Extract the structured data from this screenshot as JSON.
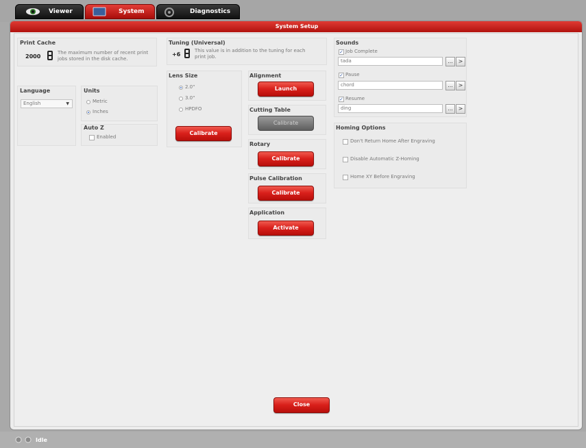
{
  "tabs": [
    {
      "label": "Viewer",
      "icon": "eye-icon"
    },
    {
      "label": "System",
      "icon": "system-icon"
    },
    {
      "label": "Diagnostics",
      "icon": "diagnostics-icon"
    }
  ],
  "window": {
    "title": "System Setup"
  },
  "print_cache": {
    "title": "Print Cache",
    "value": "2000",
    "description": "The maximum number of recent print jobs stored in the disk cache."
  },
  "tuning": {
    "title": "Tuning (Universal)",
    "value": "+6",
    "description": "This value is in addition to the tuning for each print job."
  },
  "language": {
    "title": "Language",
    "selected": "English"
  },
  "units": {
    "title": "Units",
    "options": [
      "Metric",
      "Inches"
    ],
    "selected": "Inches"
  },
  "auto_z": {
    "title": "Auto Z",
    "checkbox_label": "Enabled",
    "checked": false
  },
  "lens_size": {
    "title": "Lens Size",
    "options": [
      "2.0\"",
      "3.0\"",
      "HPDFO"
    ],
    "selected": "2.0\"",
    "button": "Calibrate"
  },
  "alignment": {
    "title": "Alignment",
    "button": "Launch"
  },
  "cutting_table": {
    "title": "Cutting Table",
    "button": "Calibrate",
    "enabled": false
  },
  "rotary": {
    "title": "Rotary",
    "button": "Calibrate"
  },
  "pulse_calibration": {
    "title": "Pulse Calibration",
    "button": "Calibrate"
  },
  "application": {
    "title": "Application",
    "button": "Activate"
  },
  "sounds": {
    "title": "Sounds",
    "items": [
      {
        "label": "Job Complete",
        "checked": true,
        "value": "tada"
      },
      {
        "label": "Pause",
        "checked": true,
        "value": "chord"
      },
      {
        "label": "Resume",
        "checked": true,
        "value": "ding"
      }
    ],
    "browse_label": "...",
    "play_label": ">"
  },
  "homing": {
    "title": "Homing Options",
    "options": [
      {
        "label": "Don't Return Home After Engraving",
        "checked": false
      },
      {
        "label": "Disable Automatic Z-Homing",
        "checked": false
      },
      {
        "label": "Home XY Before Engraving",
        "checked": false
      }
    ]
  },
  "close_button": "Close",
  "status": {
    "text": "Idle"
  },
  "colors": {
    "accent_red": "#d9201b",
    "tab_dark": "#1a1a1a",
    "panel_bg": "#ececec"
  }
}
